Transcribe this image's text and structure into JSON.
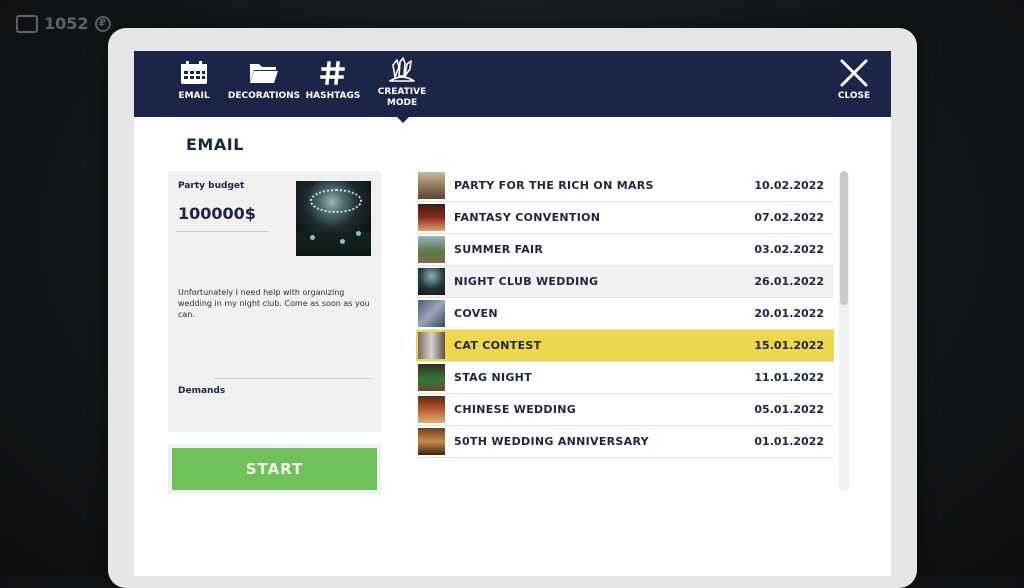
{
  "hud": {
    "money": "1052",
    "currency_symbol": "₽"
  },
  "nav": {
    "email": "EMAIL",
    "decorations": "DECORATIONS",
    "hashtags": "HASHTAGS",
    "creative_line1": "CREATIVE",
    "creative_line2": "MODE",
    "close": "CLOSE"
  },
  "section_title": "EMAIL",
  "detail": {
    "budget_label": "Party budget",
    "budget_value": "100000$",
    "description": "Unfortunately I need help with organizing wedding in my night club. Come as soon as you can.",
    "demands_label": "Demands"
  },
  "start_label": "START",
  "emails": [
    {
      "title": "PARTY FOR THE RICH ON MARS",
      "date": "10.02.2022"
    },
    {
      "title": "FANTASY CONVENTION",
      "date": "07.02.2022"
    },
    {
      "title": "SUMMER FAIR",
      "date": "03.02.2022"
    },
    {
      "title": "NIGHT CLUB WEDDING",
      "date": "26.01.2022"
    },
    {
      "title": "COVEN",
      "date": "20.01.2022"
    },
    {
      "title": "CAT CONTEST",
      "date": "15.01.2022"
    },
    {
      "title": "STAG NIGHT",
      "date": "11.01.2022"
    },
    {
      "title": "CHINESE WEDDING",
      "date": "05.01.2022"
    },
    {
      "title": "50TH WEDDING ANNIVERSARY",
      "date": "01.01.2022"
    }
  ],
  "colors": {
    "header": "#1b2548",
    "selected_row": "#ecd84a",
    "start_button": "#6fc25a"
  },
  "icons": [
    "wallet-icon",
    "ruble-icon",
    "calendar-icon",
    "folder-icon",
    "hashtag-icon",
    "crystal-icon",
    "close-icon"
  ]
}
